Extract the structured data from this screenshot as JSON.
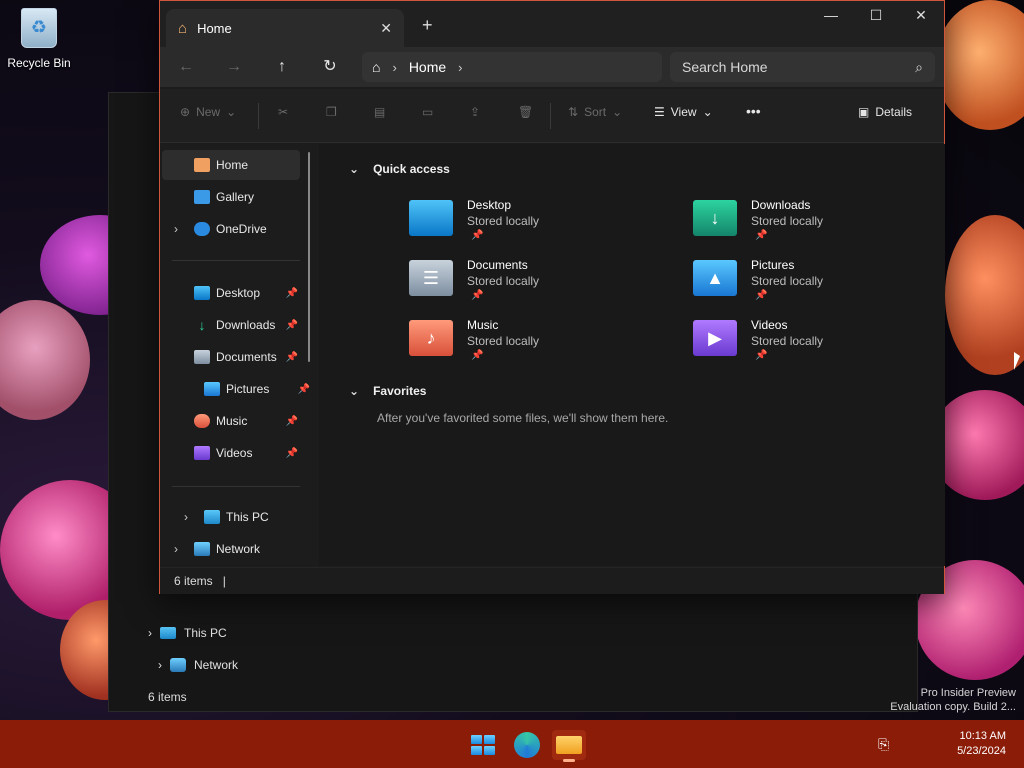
{
  "desktop": {
    "recycle_bin_label": "Recycle Bin",
    "watermark_line1": "Pro Insider Preview",
    "watermark_line2": "Evaluation copy. Build 2..."
  },
  "ghost_window": {
    "this_pc": "This PC",
    "network": "Network",
    "status": "6 items"
  },
  "window": {
    "tab_label": "Home",
    "new_tab": "+",
    "controls": {
      "minimize": "—",
      "maximize": "☐",
      "close": "✕"
    },
    "breadcrumb": {
      "location": "Home"
    },
    "search_placeholder": "Search Home",
    "toolbar": {
      "new": "New",
      "sort": "Sort",
      "view": "View",
      "more": "•••",
      "details": "Details"
    },
    "sidebar": {
      "home": "Home",
      "gallery": "Gallery",
      "onedrive": "OneDrive",
      "desktop": "Desktop",
      "downloads": "Downloads",
      "documents": "Documents",
      "pictures": "Pictures",
      "music": "Music",
      "videos": "Videos",
      "this_pc": "This PC",
      "network": "Network"
    },
    "quick_access": {
      "heading": "Quick access",
      "items": [
        {
          "name": "Desktop",
          "sub": "Stored locally"
        },
        {
          "name": "Downloads",
          "sub": "Stored locally"
        },
        {
          "name": "Documents",
          "sub": "Stored locally"
        },
        {
          "name": "Pictures",
          "sub": "Stored locally"
        },
        {
          "name": "Music",
          "sub": "Stored locally"
        },
        {
          "name": "Videos",
          "sub": "Stored locally"
        }
      ]
    },
    "favorites": {
      "heading": "Favorites",
      "empty_text": "After you've favorited some files, we'll show them here."
    },
    "status": "6 items"
  },
  "taskbar": {
    "time": "10:13 AM",
    "date": "5/23/2024"
  },
  "colors": {
    "accent_border": "#d0553a",
    "taskbar": "#8a1c08"
  }
}
